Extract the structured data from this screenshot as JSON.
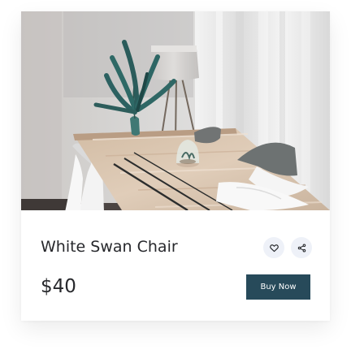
{
  "product": {
    "title": "White Swan Chair",
    "price": "$40",
    "buy_label": "Buy Now",
    "image_icon": "product-photo",
    "favorite_icon": "heart-icon",
    "share_icon": "share-icon"
  },
  "colors": {
    "button": "#274a5a",
    "text": "#27282c",
    "icon_background": "#eef1f8",
    "card_background": "#ffffff"
  }
}
